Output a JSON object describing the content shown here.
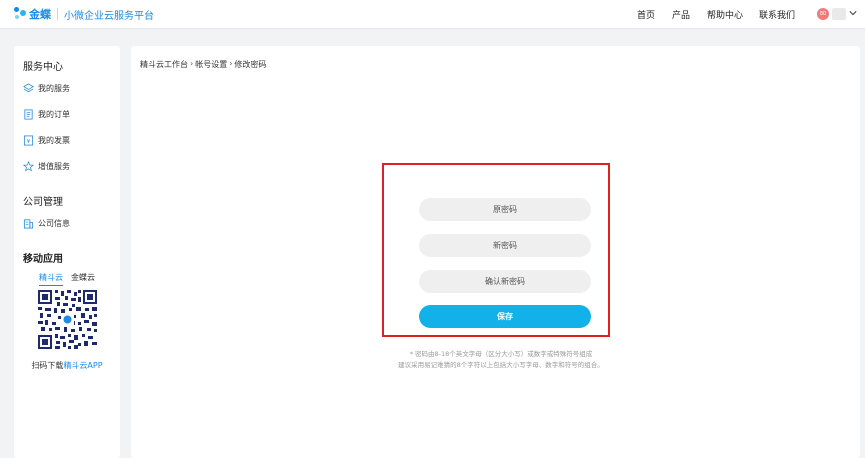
{
  "header": {
    "logo_text": "金蝶",
    "platform_name": "小微企业云服务平台",
    "nav": [
      "首页",
      "产品",
      "帮助中心",
      "联系我们"
    ],
    "avatar_text": "80",
    "brand_color": "#1a8be6"
  },
  "sidebar": {
    "service_center_title": "服务中心",
    "service_items": [
      {
        "label": "我的服务",
        "icon": "layers-icon"
      },
      {
        "label": "我的订单",
        "icon": "document-icon"
      },
      {
        "label": "我的发票",
        "icon": "invoice-icon"
      },
      {
        "label": "增值服务",
        "icon": "star-icon"
      }
    ],
    "company_title": "公司管理",
    "company_items": [
      {
        "label": "公司信息",
        "icon": "building-icon"
      }
    ],
    "mobile_title": "移动应用",
    "app_tabs": [
      "精斗云",
      "金蝶云"
    ],
    "active_app_tab": "精斗云",
    "app_caption_prefix": "扫码下载",
    "app_caption_highlight": "精斗云APP"
  },
  "breadcrumb": [
    "精斗云工作台",
    "帐号设置",
    "修改密码"
  ],
  "form": {
    "old_password_placeholder": "原密码",
    "new_password_placeholder": "新密码",
    "confirm_password_placeholder": "确认新密码",
    "save_label": "保存",
    "hint_line1": "* 密码由8-18个英文字母（区分大小写）或数字或特殊符号组成",
    "hint_line2": "建议采用易记难猜的8个字符以上包括大小写字母、数字和符号的组合。",
    "highlight_border_color": "#e02020",
    "save_button_color": "#12b1ea"
  }
}
